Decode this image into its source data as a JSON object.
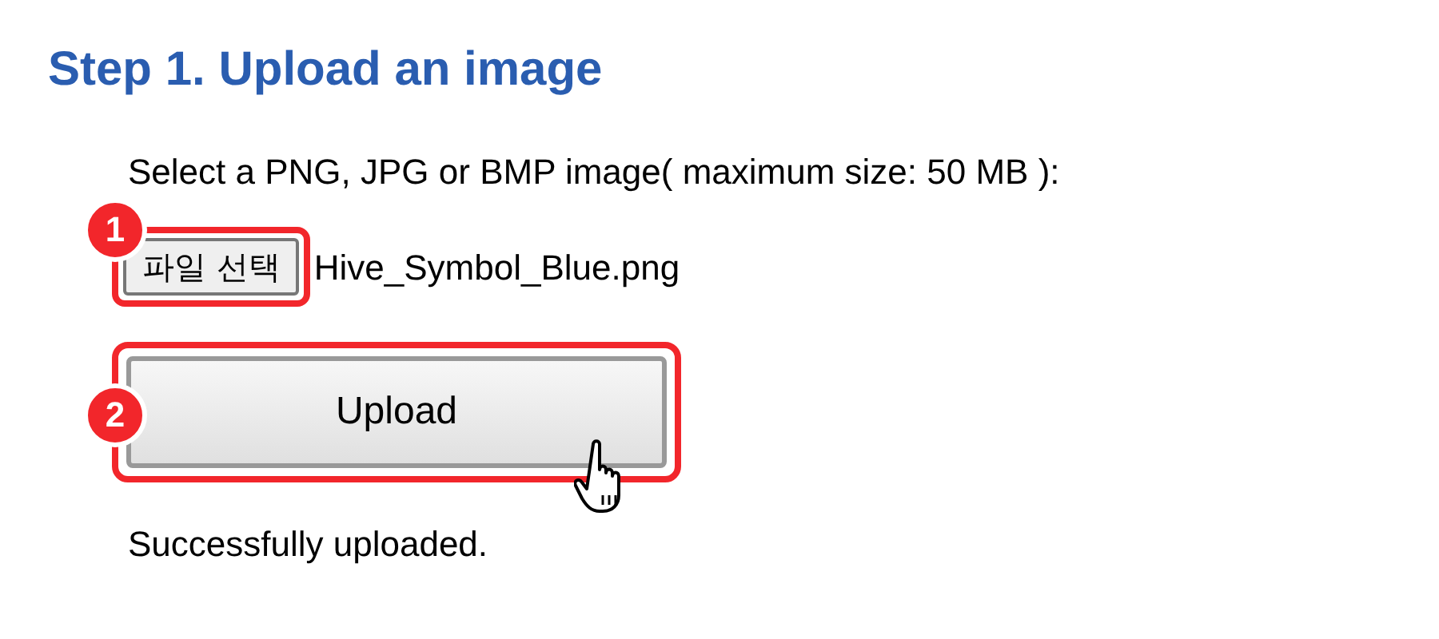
{
  "heading": "Step 1. Upload an image",
  "instruction": "Select a PNG, JPG or BMP image( maximum size: 50 MB ):",
  "file_button": {
    "label": "파일 선택",
    "badge": "1"
  },
  "file_name": "Hive_Symbol_Blue.png",
  "upload_button": {
    "label": "Upload",
    "badge": "2"
  },
  "status": "Successfully uploaded."
}
